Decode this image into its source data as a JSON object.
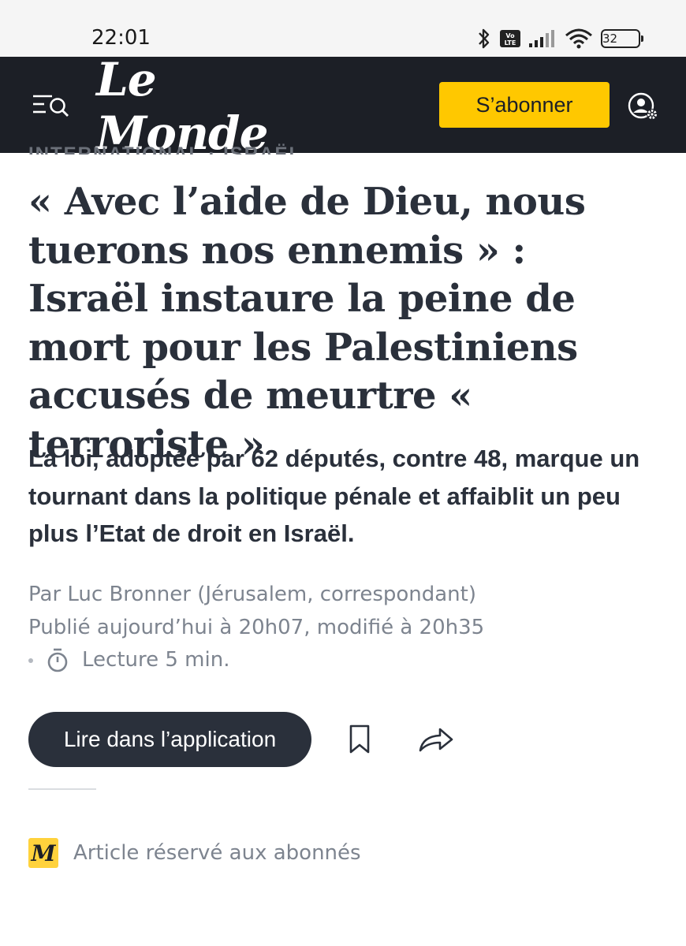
{
  "status_bar": {
    "time": "22:01",
    "battery": "32",
    "volte_label": "Vo LTE",
    "icons": [
      "bluetooth-icon",
      "volte-icon",
      "signal-icon",
      "wifi-icon",
      "battery-icon"
    ]
  },
  "header": {
    "logo": "Le Monde",
    "subscribe_label": "S’abonner",
    "icons": [
      "menu-search-icon",
      "account-settings-icon"
    ],
    "background": "#1c1f26",
    "accent": "#ffc800"
  },
  "article": {
    "rubric": "INTERNATIONAL · ISRAËL",
    "headline": "« Avec l’aide de Dieu, nous tuerons nos ennemis » : Israël instaure la peine de mort pour les Palestiniens accusés de meurtre « terroriste »",
    "standfirst": "La loi, adoptée par 62 députés, contre 48, marque un tournant dans la politique pénale et affaiblit un peu plus l’Etat de droit en Israël.",
    "author": "Par Luc Bronner (Jérusalem, correspondant)",
    "published": "Publié aujourd’hui à 20h07, modifié à 20h35",
    "reading_time": "Lecture 5 min."
  },
  "actions": {
    "read_in_app_label": "Lire dans l’application",
    "icons": [
      "bookmark-icon",
      "share-icon"
    ]
  },
  "premium": {
    "icon_letter": "M",
    "label": "Article réservé aux abonnés",
    "color": "#ffd23c"
  }
}
